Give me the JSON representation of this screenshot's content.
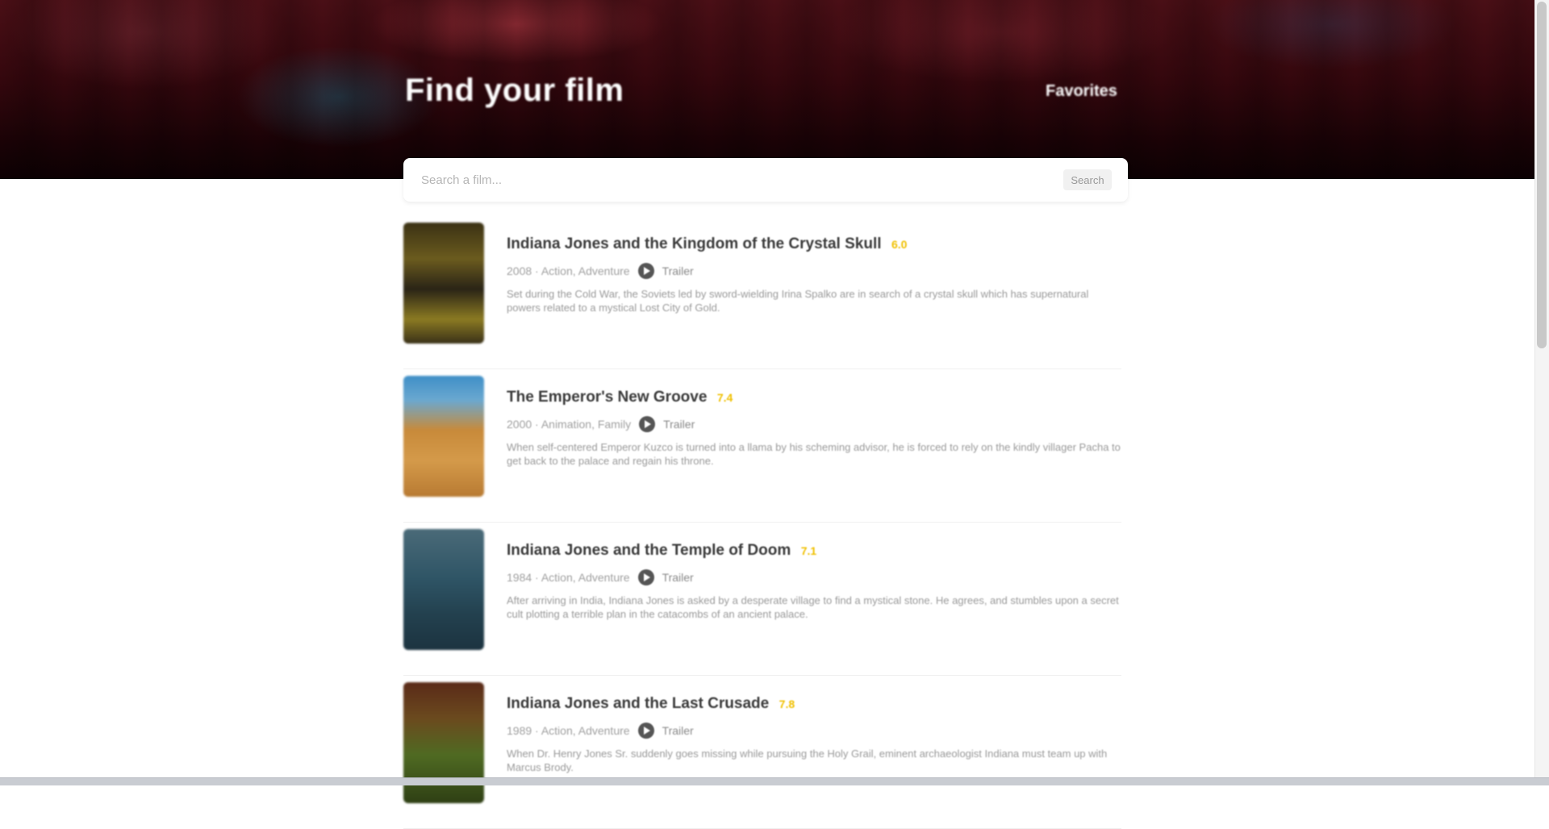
{
  "hero": {
    "title": "Find your film",
    "link_label": "Favorites"
  },
  "search": {
    "placeholder": "Search a film...",
    "button_label": "Search"
  },
  "results": [
    {
      "title": "Indiana Jones and the Kingdom of the Crystal Skull",
      "rating": "6.0",
      "meta": "2008 · Action, Adventure",
      "trailer_label": "Trailer",
      "description": "Set during the Cold War, the Soviets led by sword-wielding Irina Spalko are in search of a crystal skull which has supernatural powers related to a mystical Lost City of Gold."
    },
    {
      "title": "The Emperor's New Groove",
      "rating": "7.4",
      "meta": "2000 · Animation, Family",
      "trailer_label": "Trailer",
      "description": "When self-centered Emperor Kuzco is turned into a llama by his scheming advisor, he is forced to rely on the kindly villager Pacha to get back to the palace and regain his throne."
    },
    {
      "title": "Indiana Jones and the Temple of Doom",
      "rating": "7.1",
      "meta": "1984 · Action, Adventure",
      "trailer_label": "Trailer",
      "description": "After arriving in India, Indiana Jones is asked by a desperate village to find a mystical stone. He agrees, and stumbles upon a secret cult plotting a terrible plan in the catacombs of an ancient palace."
    },
    {
      "title": "Indiana Jones and the Last Crusade",
      "rating": "7.8",
      "meta": "1989 · Action, Adventure",
      "trailer_label": "Trailer",
      "description": "When Dr. Henry Jones Sr. suddenly goes missing while pursuing the Holy Grail, eminent archaeologist Indiana must team up with Marcus Brody."
    }
  ]
}
